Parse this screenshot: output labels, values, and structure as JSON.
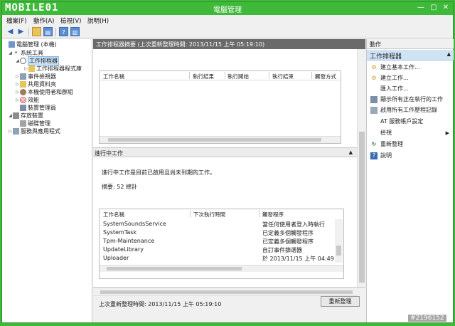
{
  "window": {
    "title": "電腦管理",
    "logo_text": "MOBILE01"
  },
  "window_controls": {
    "minimize": "—",
    "maximize": "▢",
    "close": "✕"
  },
  "menu": [
    "檔案(F)",
    "動作(A)",
    "檢視(V)",
    "說明(H)"
  ],
  "tree": {
    "items": [
      {
        "label": "電腦管理 (本機)",
        "icon": "computer-icon"
      },
      {
        "label": "系統工具",
        "icon": "tools-icon"
      },
      {
        "label": "工作排程器",
        "icon": "clock-icon"
      },
      {
        "label": "工作排程器程式庫",
        "icon": "folder-icon"
      },
      {
        "label": "事件檢視器",
        "icon": "event-viewer-icon"
      },
      {
        "label": "共用資料夾",
        "icon": "shared-folder-icon"
      },
      {
        "label": "本機使用者和群組",
        "icon": "users-icon"
      },
      {
        "label": "效能",
        "icon": "performance-icon"
      },
      {
        "label": "裝置管理員",
        "icon": "device-manager-icon"
      },
      {
        "label": "存放裝置",
        "icon": "storage-icon"
      },
      {
        "label": "磁碟管理",
        "icon": "disk-icon"
      },
      {
        "label": "服務與應用程式",
        "icon": "services-icon"
      }
    ]
  },
  "center": {
    "header": "工作排程器摘要 (上次重新整理時間: 2013/11/15 上午 05:19:10)",
    "task_status_table": {
      "columns": [
        "工作名稱",
        "執行結果",
        "執行開始",
        "執行結束",
        "觸發方式"
      ]
    },
    "active_tasks": {
      "title": "進行中工作",
      "description": "進行中工作是目前已啟用且尚未到期的工作。",
      "summary": "摘要: 52 總計",
      "columns": [
        "工作名稱",
        "下次執行時間",
        "觸發程序"
      ],
      "rows": [
        {
          "name": "SystemSoundsService",
          "next": "",
          "trigger": "當任何使用者登入時執行"
        },
        {
          "name": "SystemTask",
          "next": "",
          "trigger": "已定義多個觸發程序"
        },
        {
          "name": "Tpm-Maintenance",
          "next": "",
          "trigger": "已定義多個觸發程序"
        },
        {
          "name": "UpdateLibrary",
          "next": "",
          "trigger": "自訂事件篩選器"
        },
        {
          "name": "Uploader",
          "next": "",
          "trigger": "於 2013/11/15 上午 04:49"
        }
      ]
    },
    "footer": {
      "last_refresh": "上次重新整理時間: 2013/11/15 上午 05:19:10",
      "refresh_button": "重新整理"
    }
  },
  "actions": {
    "header": "動作",
    "section": "工作排程器",
    "items": [
      {
        "label": "建立基本工作...",
        "icon": "create-basic-task-icon"
      },
      {
        "label": "建立工作...",
        "icon": "create-task-icon"
      },
      {
        "label": "匯入工作...",
        "icon": ""
      },
      {
        "label": "顯示所有正在執行的工作",
        "icon": "running-tasks-icon"
      },
      {
        "label": "啟用所有工作歷程記錄",
        "icon": "history-icon"
      },
      {
        "label": "AT 服務帳戶設定",
        "icon": ""
      },
      {
        "label": "檢視",
        "icon": "",
        "submenu": true
      },
      {
        "label": "重新整理",
        "icon": "refresh-icon"
      },
      {
        "label": "說明",
        "icon": "help-icon"
      }
    ]
  },
  "watermark": "#2196152"
}
